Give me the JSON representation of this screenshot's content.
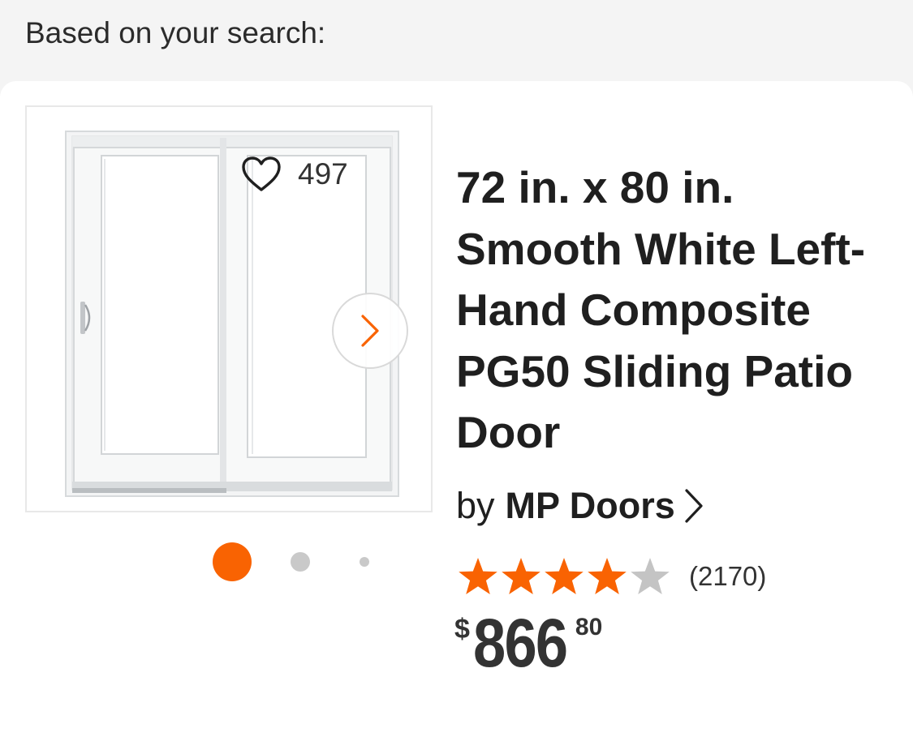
{
  "header": {
    "text": "Based on your search:"
  },
  "product": {
    "title": "72 in. x 80 in. Smooth White Left-Hand Composite PG50 Sliding Patio Door",
    "image_alt": "Sliding patio door",
    "favorites_count": "497",
    "by_label": "by",
    "brand": "MP Doors",
    "rating": {
      "value": 4,
      "max": 5,
      "review_count": "(2170)"
    },
    "price": {
      "currency_symbol": "$",
      "dollars": "866",
      "cents": "80"
    }
  },
  "carousel": {
    "total_slides": 3,
    "active_index": 0
  },
  "icons": {
    "favorite": "heart-outline-icon",
    "next": "chevron-right-icon",
    "brand_link": "chevron-right-icon",
    "star": "star-icon"
  },
  "colors": {
    "accent": "#f96302",
    "star_filled": "#f96302",
    "star_empty": "#c4c4c4",
    "dot_inactive": "#c9c9c9",
    "text": "#1f1f1f",
    "background": "#f4f4f4"
  }
}
